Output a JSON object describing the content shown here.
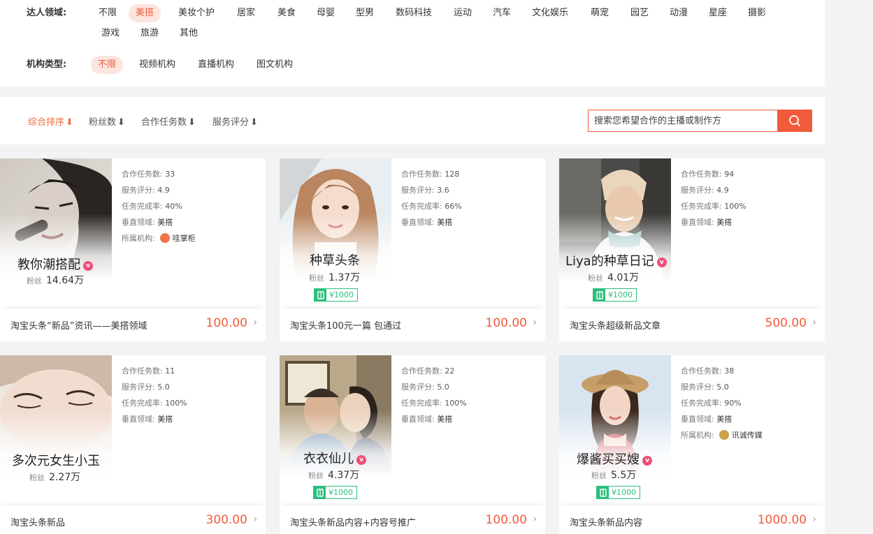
{
  "filters": {
    "domain_label": "达人领域:",
    "domain_options": [
      "不限",
      "美搭",
      "美妆个护",
      "居家",
      "美食",
      "母婴",
      "型男",
      "数码科技",
      "运动",
      "汽车",
      "文化娱乐",
      "萌宠",
      "园艺",
      "动漫",
      "星座",
      "摄影",
      "游戏",
      "旅游",
      "其他"
    ],
    "domain_selected": "美搭",
    "org_label": "机构类型:",
    "org_options": [
      "不限",
      "视频机构",
      "直播机构",
      "图文机构"
    ],
    "org_selected": "不限"
  },
  "sort": {
    "items": [
      "综合排序",
      "粉丝数",
      "合作任务数",
      "服务评分"
    ],
    "active": "综合排序",
    "arrow": "⬇"
  },
  "search": {
    "placeholder": "搜索您希望合作的主播或制作方"
  },
  "labels": {
    "tasks": "合作任务数:",
    "rating": "服务评分:",
    "completion": "任务完成率:",
    "vertical": "垂直领域:",
    "org": "所属机构:",
    "fans": "粉丝"
  },
  "cards": [
    {
      "name": "教你潮搭配",
      "verified": true,
      "fans": "14.64万",
      "tasks": "33",
      "rating": "4.9",
      "completion": "40%",
      "vertical": "美搭",
      "org": "哇掌柜",
      "price_tag": "",
      "title": "淘宝头条“新品”资讯——美搭领域",
      "price": "100.00"
    },
    {
      "name": "种草头条",
      "verified": false,
      "fans": "1.37万",
      "tasks": "128",
      "rating": "3.6",
      "completion": "66%",
      "vertical": "美搭",
      "org": "",
      "price_tag": "¥1000",
      "title": "淘宝头条100元一篇 包通过",
      "price": "100.00"
    },
    {
      "name": "Liya的种草日记",
      "verified": true,
      "fans": "4.01万",
      "tasks": "94",
      "rating": "4.9",
      "completion": "100%",
      "vertical": "美搭",
      "org": "",
      "price_tag": "¥1000",
      "title": "淘宝头条超级新品文章",
      "price": "500.00"
    },
    {
      "name": "多次元女生小玉",
      "verified": false,
      "fans": "2.27万",
      "tasks": "11",
      "rating": "5.0",
      "completion": "100%",
      "vertical": "美搭",
      "org": "",
      "price_tag": "",
      "title": "淘宝头条新品",
      "price": "300.00"
    },
    {
      "name": "衣衣仙儿",
      "verified": true,
      "fans": "4.37万",
      "tasks": "22",
      "rating": "5.0",
      "completion": "100%",
      "vertical": "美搭",
      "org": "",
      "price_tag": "¥1000",
      "title": "淘宝头条新品内容+内容号推广",
      "price": "100.00"
    },
    {
      "name": "爆酱买买嫂",
      "verified": true,
      "fans": "5.5万",
      "tasks": "38",
      "rating": "5.0",
      "completion": "90%",
      "vertical": "美搭",
      "org": "讯诚传媒",
      "price_tag": "¥1000",
      "title": "淘宝头条新品内容",
      "price": "1000.00"
    }
  ],
  "colors": {
    "accent": "#f15a3a",
    "sort_active": "#f26c3c",
    "verified": "#ef4f79",
    "price_tag": "#2bbf7d"
  }
}
